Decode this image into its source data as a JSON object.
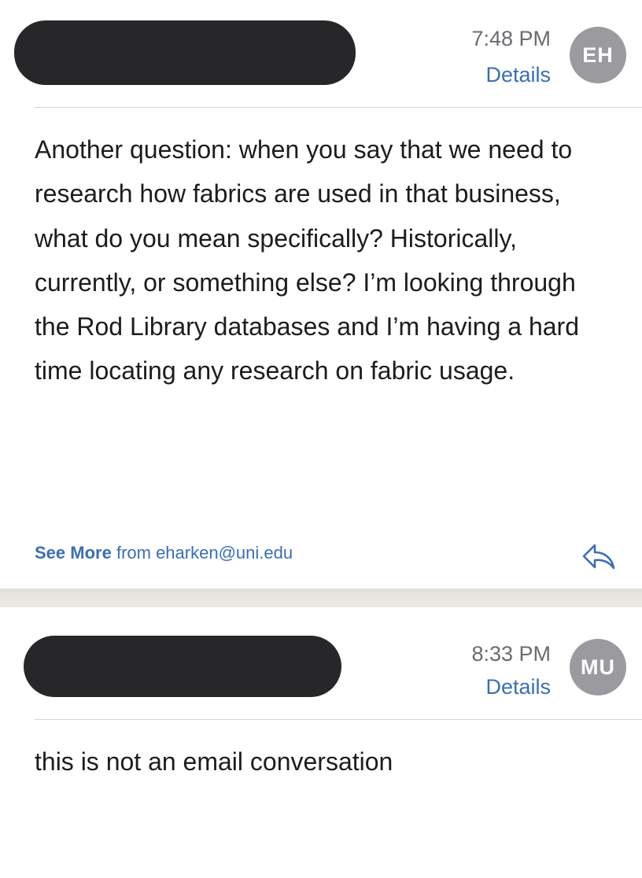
{
  "messages": [
    {
      "time": "7:48 PM",
      "details_label": "Details",
      "avatar_initials": "EH",
      "body": "Another question: when you say that we need to research how fabrics are used in that business, what do you mean specifically? Historically, currently, or something else? I’m looking through the Rod Library databases and I’m having a hard time locating any research on fabric usage.",
      "footer": {
        "see_more_label": "See More",
        "from_text": "from eharken@uni.edu"
      },
      "reply_icon": "reply-arrow-icon"
    },
    {
      "time": "8:33 PM",
      "details_label": "Details",
      "avatar_initials": "MU",
      "body": "this is not an email conversation"
    }
  ],
  "colors": {
    "link": "#3b6fb0",
    "avatar_bg": "#9a9a9f",
    "redaction": "#27272a",
    "separator": "#e6e2de"
  }
}
